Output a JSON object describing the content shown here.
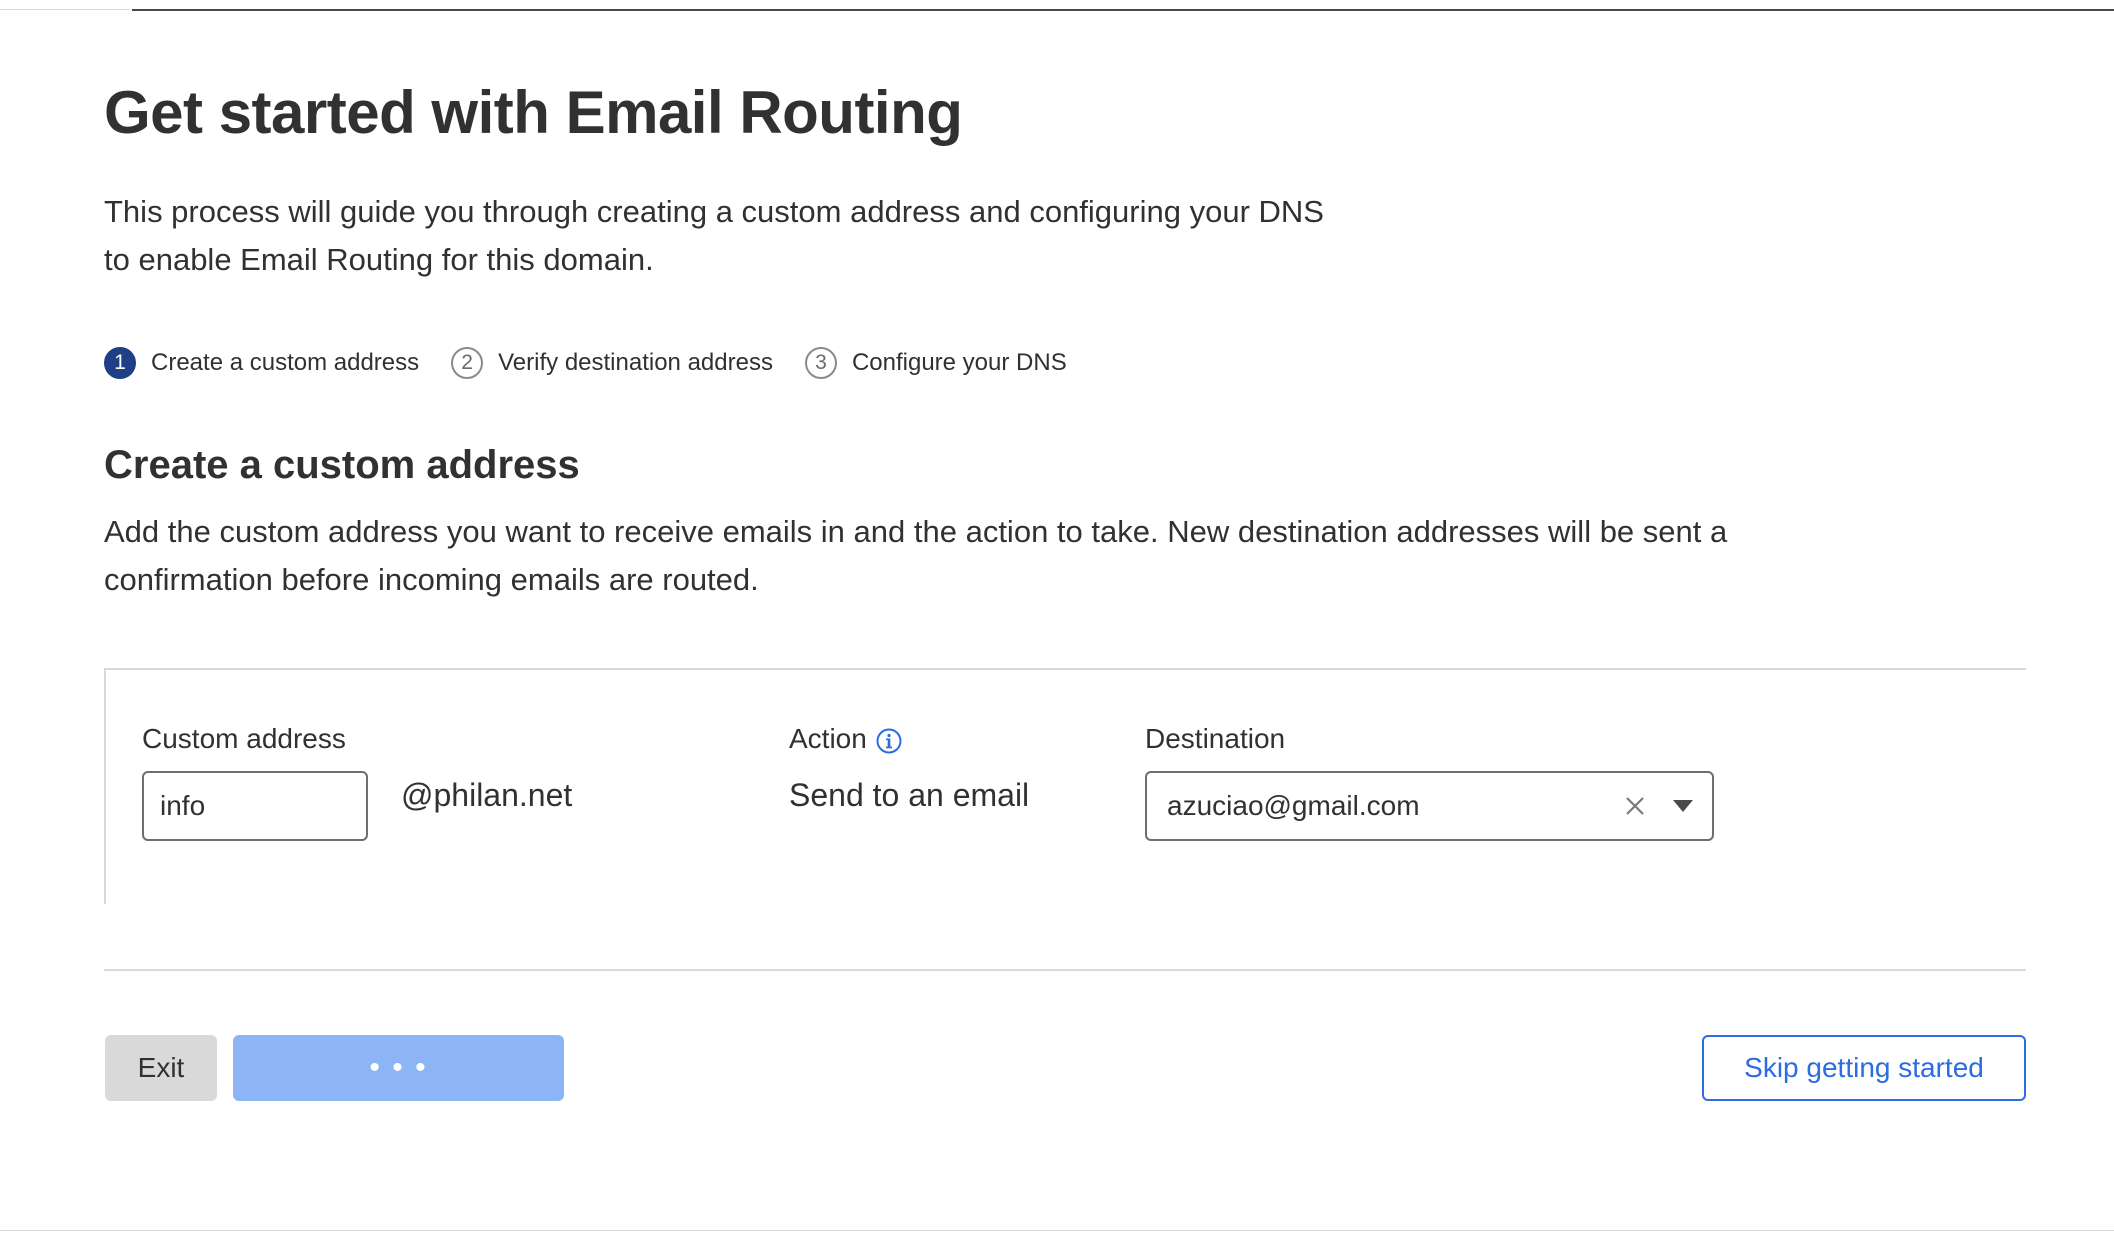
{
  "page": {
    "title": "Get started with Email Routing",
    "intro_line1": "This process will guide you through creating a custom address and configuring your DNS",
    "intro_line2": "to enable Email Routing for this domain."
  },
  "steps": [
    {
      "number": "1",
      "label": "Create a custom address",
      "active": true
    },
    {
      "number": "2",
      "label": "Verify destination address",
      "active": false
    },
    {
      "number": "3",
      "label": "Configure your DNS",
      "active": false
    }
  ],
  "section": {
    "title": "Create a custom address",
    "desc_line1": "Add the custom address you want to receive emails in and the action to take. New destination addresses will be sent a",
    "desc_line2": "confirmation before incoming emails are routed."
  },
  "form": {
    "custom_address_label": "Custom address",
    "custom_address_value": "info",
    "domain_suffix": "@philan.net",
    "action_label": "Action",
    "action_value": "Send to an email",
    "destination_label": "Destination",
    "destination_value": "azuciao@gmail.com"
  },
  "buttons": {
    "exit_label": "Exit",
    "continue_loading_label": "• • •",
    "skip_label": "Skip getting started"
  },
  "colors": {
    "active_step": "#1f3f86",
    "primary_loading": "#8db4f5",
    "link_blue": "#2c6be0",
    "info_icon": "#2c6be0"
  },
  "icons": {
    "info": "info-icon",
    "clear": "close-icon",
    "dropdown": "chevron-down-icon"
  }
}
